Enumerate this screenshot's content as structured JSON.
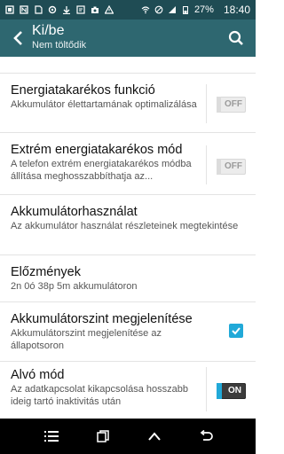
{
  "status_bar": {
    "battery_percent": "27%",
    "time": "18:40"
  },
  "app_bar": {
    "title": "Ki/be",
    "subtitle": "Nem töltődik"
  },
  "settings": [
    {
      "title": "Energiatakarékos funkció",
      "desc": "Akkumulátor élettartamának optimalizálása",
      "control": "toggle",
      "state": "OFF"
    },
    {
      "title": "Extrém energiatakarékos mód",
      "desc": "A telefon extrém energiatakarékos módba állítása meghosszabbíthatja az...",
      "control": "toggle",
      "state": "OFF"
    },
    {
      "title": "Akkumulátorhasználat",
      "desc": "Az akkumulátor használat részleteinek megtekintése",
      "control": "none"
    },
    {
      "title": "Előzmények",
      "desc": "2n 0ó 38p 5m akkumulátoron",
      "control": "none"
    },
    {
      "title": "Akkumulátorszint megjelenítése",
      "desc": "Akkumulátorszint megjelenítése az állapotsoron",
      "control": "checkbox",
      "checked": true
    },
    {
      "title": "Alvó mód",
      "desc": "Az adatkapcsolat kikapcsolása hosszabb ideig tartó inaktivitás után",
      "control": "toggle",
      "state": "ON"
    }
  ],
  "colors": {
    "status_bar": "#1f4c54",
    "app_bar": "#2e6770",
    "accent": "#21a9d8"
  },
  "icons": {
    "back": "back-arrow-icon",
    "search": "search-icon",
    "nav_recent": "recent-apps-icon",
    "nav_home": "home-icon",
    "nav_back": "back-nav-icon"
  }
}
